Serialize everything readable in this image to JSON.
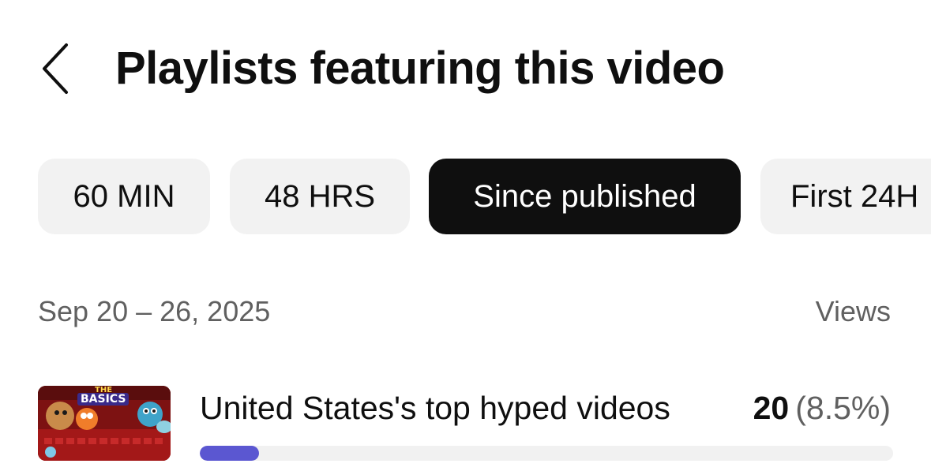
{
  "header": {
    "title": "Playlists featuring this video",
    "back_icon": "chevron-left-icon"
  },
  "filters": {
    "chips": [
      {
        "label": "60 MIN",
        "active": false
      },
      {
        "label": "48 HRS",
        "active": false
      },
      {
        "label": "Since published",
        "active": true
      },
      {
        "label": "First 24H",
        "active": false
      }
    ]
  },
  "list_header": {
    "date_range": "Sep 20 – 26, 2025",
    "metric": "Views"
  },
  "playlists": [
    {
      "title": "United States's top hyped videos",
      "views": "20",
      "share": "(8.5%)",
      "share_fraction": 0.085,
      "thumb_text": "BASICS",
      "thumb_top": "THE"
    }
  ],
  "colors": {
    "accent": "#5b57d1",
    "active_chip": "#0f0f0f",
    "chip": "#f2f2f2",
    "muted_text": "#606060"
  }
}
